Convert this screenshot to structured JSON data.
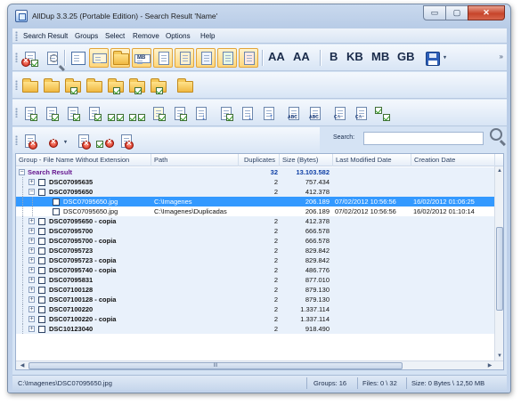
{
  "window": {
    "title": "AllDup 3.3.25 (Portable Edition) - Search Result 'Name'"
  },
  "caption": {
    "minimize": "▭",
    "maximize": "▢",
    "close": "✕"
  },
  "menu": [
    "Search Result",
    "Groups",
    "Select",
    "Remove",
    "Options",
    "Help"
  ],
  "toolbar": {
    "font_increase": "AA",
    "font_decrease": "AA",
    "unit_b": "B",
    "unit_kb": "KB",
    "unit_mb": "MB",
    "unit_gb": "GB",
    "mb_small": "MB",
    "abc": "ABC",
    "drive": "C:\\"
  },
  "search": {
    "label": "Search:",
    "value": "",
    "placeholder": ""
  },
  "grid": {
    "headers": [
      "Group - File Name Without Extension",
      "Path",
      "Duplicates",
      "Size (Bytes)",
      "Last Modified Date",
      "Creation Date"
    ],
    "rows": [
      {
        "type": "root",
        "name": "Search Result",
        "path": "",
        "dup": "32",
        "size": "13.103.582",
        "mod": "",
        "created": ""
      },
      {
        "type": "group",
        "expander": "+",
        "name": "DSC07095635",
        "path": "",
        "dup": "2",
        "size": "757.434",
        "mod": "",
        "created": ""
      },
      {
        "type": "group",
        "expander": "−",
        "name": "DSC07095650",
        "path": "",
        "dup": "2",
        "size": "412.378",
        "mod": "",
        "created": ""
      },
      {
        "type": "file",
        "selected": true,
        "name": "DSC07095650.jpg",
        "path": "C:\\Imagenes",
        "dup": "",
        "size": "206.189",
        "mod": "07/02/2012 10:56:56",
        "created": "16/02/2012 01:06:25"
      },
      {
        "type": "file",
        "selected": false,
        "name": "DSC07095650.jpg",
        "path": "C:\\Imagenes\\Duplicadas",
        "dup": "",
        "size": "206.189",
        "mod": "07/02/2012 10:56:56",
        "created": "16/02/2012 01:10:14"
      },
      {
        "type": "group",
        "expander": "+",
        "name": "DSC07095650 - copia",
        "path": "",
        "dup": "2",
        "size": "412.378",
        "mod": "",
        "created": ""
      },
      {
        "type": "group",
        "expander": "+",
        "name": "DSC07095700",
        "path": "",
        "dup": "2",
        "size": "666.578",
        "mod": "",
        "created": ""
      },
      {
        "type": "group",
        "expander": "+",
        "name": "DSC07095700 - copia",
        "path": "",
        "dup": "2",
        "size": "666.578",
        "mod": "",
        "created": ""
      },
      {
        "type": "group",
        "expander": "+",
        "name": "DSC07095723",
        "path": "",
        "dup": "2",
        "size": "829.842",
        "mod": "",
        "created": ""
      },
      {
        "type": "group",
        "expander": "+",
        "name": "DSC07095723 - copia",
        "path": "",
        "dup": "2",
        "size": "829.842",
        "mod": "",
        "created": ""
      },
      {
        "type": "group",
        "expander": "+",
        "name": "DSC07095740 - copia",
        "path": "",
        "dup": "2",
        "size": "486.776",
        "mod": "",
        "created": ""
      },
      {
        "type": "group",
        "expander": "+",
        "name": "DSC07095831",
        "path": "",
        "dup": "2",
        "size": "877.010",
        "mod": "",
        "created": ""
      },
      {
        "type": "group",
        "expander": "+",
        "name": "DSC07100128",
        "path": "",
        "dup": "2",
        "size": "879.130",
        "mod": "",
        "created": ""
      },
      {
        "type": "group",
        "expander": "+",
        "name": "DSC07100128 - copia",
        "path": "",
        "dup": "2",
        "size": "879.130",
        "mod": "",
        "created": ""
      },
      {
        "type": "group",
        "expander": "+",
        "name": "DSC07100220",
        "path": "",
        "dup": "2",
        "size": "1.337.114",
        "mod": "",
        "created": ""
      },
      {
        "type": "group",
        "expander": "+",
        "name": "DSC07100220 - copia",
        "path": "",
        "dup": "2",
        "size": "1.337.114",
        "mod": "",
        "created": ""
      },
      {
        "type": "group",
        "expander": "+",
        "name": "DSC10123040",
        "path": "",
        "dup": "2",
        "size": "918.490",
        "mod": "",
        "created": ""
      }
    ]
  },
  "scroll": {
    "grip": "III"
  },
  "status": {
    "path": "C:\\Imagenes\\DSC07095650.jpg",
    "groups": "Groups: 16",
    "files": "Files: 0 \\ 32",
    "size": "Size: 0 Bytes \\ 12,50 MB"
  },
  "colors": {
    "selected_row": "#3399ff",
    "root_text": "#66178f",
    "total_text": "#0d3ea5"
  }
}
